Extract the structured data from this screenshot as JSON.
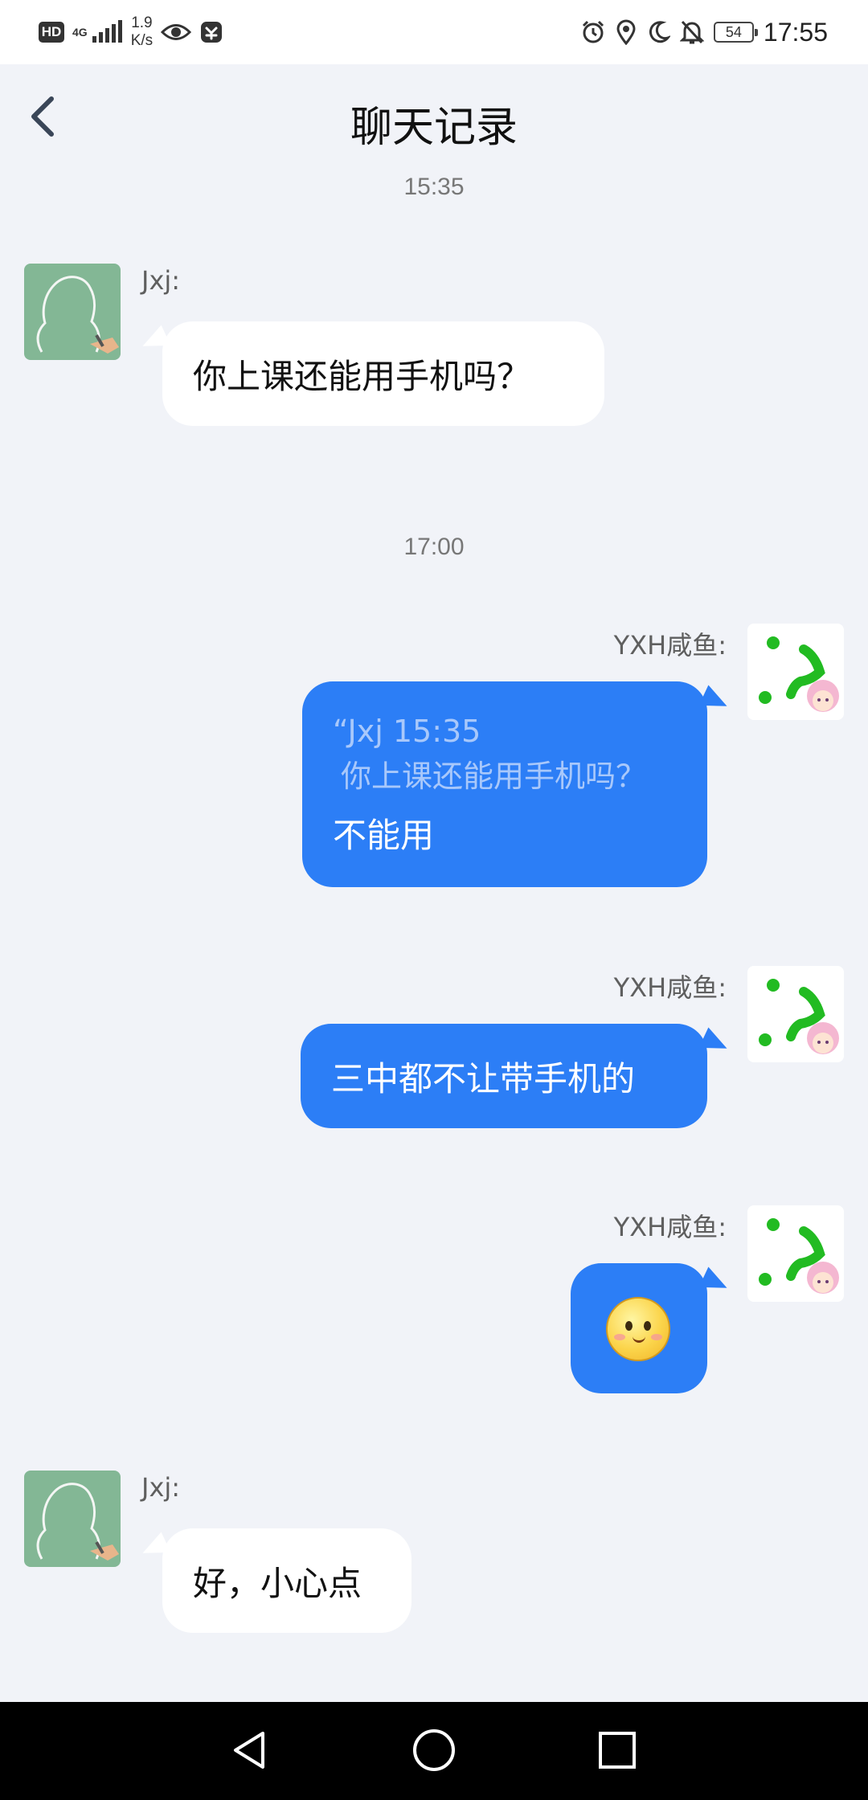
{
  "status_bar": {
    "hd_label": "HD",
    "network_label": "4G",
    "net_speed_value": "1.9",
    "net_speed_unit": "K/s",
    "battery": "54",
    "time": "17:55",
    "icons": [
      "hd-icon",
      "signal-icon",
      "eye-icon",
      "app-notification-icon",
      "alarm-icon",
      "location-icon",
      "moon-icon",
      "bell-off-icon",
      "battery-icon"
    ]
  },
  "header": {
    "title": "聊天记录",
    "back_icon": "chevron-left-icon"
  },
  "messages": [
    {
      "type": "timestamp",
      "text": "15:35"
    },
    {
      "type": "message",
      "side": "left",
      "sender": "Jxj:",
      "text": "你上课还能用手机吗？"
    },
    {
      "type": "timestamp",
      "text": "17:00"
    },
    {
      "type": "message",
      "side": "right",
      "sender": "YXH咸鱼:",
      "quote_header": "“Jxj 15:35",
      "quote_text": "你上课还能用手机吗？",
      "text": "不能用"
    },
    {
      "type": "message",
      "side": "right",
      "sender": "YXH咸鱼:",
      "text": "三中都不让带手机的"
    },
    {
      "type": "message",
      "side": "right",
      "sender": "YXH咸鱼:",
      "sticker": "smiling-face-emoji"
    },
    {
      "type": "message",
      "side": "left",
      "sender": "Jxj:",
      "text": "好，小心点"
    }
  ],
  "colors": {
    "background": "#f1f3f8",
    "bubble_self": "#2c7ef6",
    "bubble_other": "#ffffff",
    "quote_text": "#a8c8fb"
  },
  "nav_bar": {
    "icons": [
      "back-triangle-icon",
      "home-circle-icon",
      "recents-square-icon"
    ]
  }
}
